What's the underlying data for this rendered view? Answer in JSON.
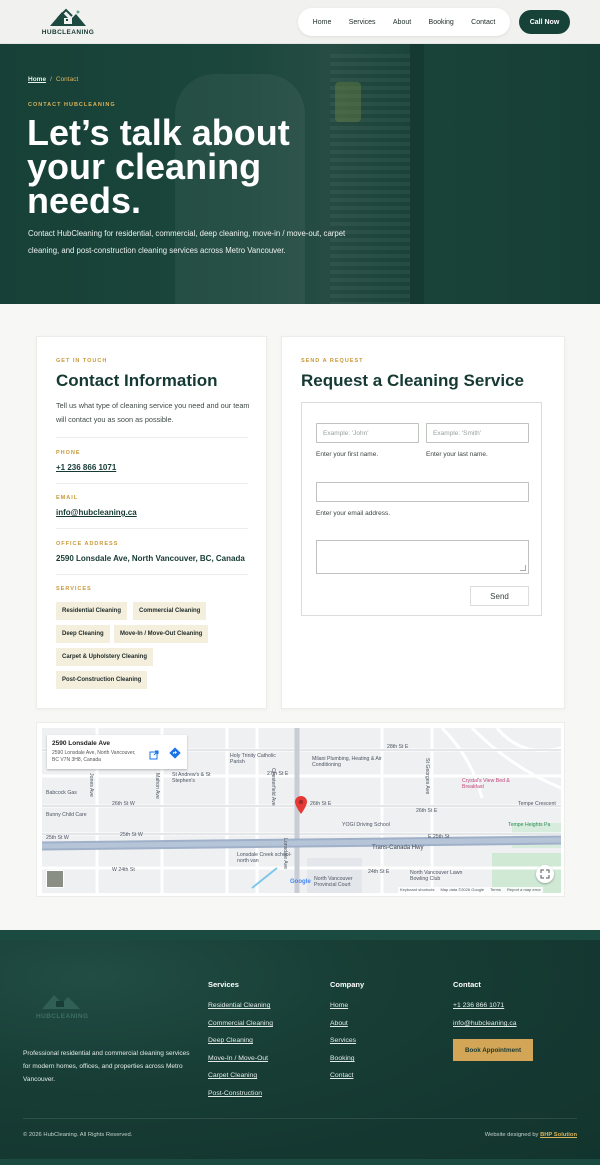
{
  "header": {
    "logo_text": "HUBCLEANING",
    "nav": [
      "Home",
      "Services",
      "About",
      "Booking",
      "Contact"
    ],
    "cta": "Call Now"
  },
  "hero": {
    "breadcrumb_home": "Home",
    "breadcrumb_sep": "/",
    "breadcrumb_current": "Contact",
    "eyebrow": "CONTACT HUBCLEANING",
    "title": "Let’s talk about your cleaning needs.",
    "description": "Contact HubCleaning for residential, commercial, deep cleaning, move-in / move-out, carpet cleaning, and post-construction cleaning services across Metro Vancouver."
  },
  "contact_card": {
    "eyebrow": "GET IN TOUCH",
    "title": "Contact Information",
    "description": "Tell us what type of cleaning service you need and our team will contact you as soon as possible.",
    "phone_label": "PHONE",
    "phone": "+1 236 866 1071",
    "email_label": "EMAIL",
    "email": "info@hubcleaning.ca",
    "address_label": "OFFICE ADDRESS",
    "address": "2590 Lonsdale Ave, North Vancouver, BC, Canada",
    "services_label": "SERVICES",
    "services": [
      "Residential Cleaning",
      "Commercial Cleaning",
      "Deep Cleaning",
      "Move-In / Move-Out Cleaning",
      "Carpet & Upholstery Cleaning",
      "Post-Construction Cleaning"
    ]
  },
  "request_card": {
    "eyebrow": "SEND A REQUEST",
    "title": "Request a Cleaning Service",
    "first_placeholder": "Example: 'John'",
    "first_help": "Enter your first name.",
    "last_placeholder": "Example: 'Smith'",
    "last_help": "Enter your last name.",
    "email_placeholder": "",
    "email_help": "Enter your email address.",
    "message_placeholder": "",
    "send": "Send"
  },
  "map": {
    "place_title": "2590 Lonsdale Ave",
    "place_address": "2590 Lonsdale Ave, North Vancouver, BC V7N 3H8, Canada",
    "labels": {
      "holy_trinity": "Holy Trinity Catholic Parish",
      "milani": "Milani Plumbing, Heating & Air Conditioning",
      "st_andrews": "St Andrew's & St Stephen's",
      "babcock": "Babcock Gas",
      "bunny": "Bunny Child Care",
      "crystals": "Crystal's View Bed & Breakfast",
      "yogi": "YOGI Driving School",
      "tempe_heights": "Tempe Heights Pa",
      "lonsdale_school": "Lonsdale Creek school-north van",
      "nv_court": "North Vancouver Provincial Court",
      "lawn_bowling": "North Vancouver Lawn Bowling Club",
      "trans_canada": "Trans-Canada Hwy",
      "st_28": "28th St E",
      "st_27": "27th St E",
      "st_26e": "26th St E",
      "st_26w": "26th St W",
      "st_26e2": "26th St E",
      "st_25w": "25th St W",
      "st_25w2": "25th St W",
      "st_25e": "E 25th St",
      "st_24e": "24th St E",
      "st_24w": "W 24th St",
      "lonsdale_ave": "Lonsdale Ave",
      "chesterfield": "Chesterfield Ave",
      "jones": "Jones Ave",
      "mahon": "Mahon Ave",
      "st_georges": "St Georges Ave",
      "tempe_cres": "Tempe Crescent",
      "keyboard": "Keyboard shortcuts",
      "mapdata": "Map data ©2026 Google",
      "terms": "Terms",
      "report": "Report a map error",
      "google": "Google"
    }
  },
  "footer": {
    "logo_text": "HUBCLEANING",
    "description": "Professional residential and commercial cleaning services for modern homes, offices, and properties across Metro Vancouver.",
    "services_title": "Services",
    "services": [
      "Residential Cleaning",
      "Commercial Cleaning",
      "Deep Cleaning",
      "Move-In / Move-Out",
      "Carpet Cleaning",
      "Post-Construction"
    ],
    "company_title": "Company",
    "company": [
      "Home",
      "About",
      "Services",
      "Booking",
      "Contact"
    ],
    "contact_title": "Contact",
    "phone": "+1 236 866 1071",
    "email": "info@hubcleaning.ca",
    "cta": "Book Appointment",
    "copyright": "© 2026 HubCleaning. All Rights Reserved.",
    "credit_prefix": "Website designed by ",
    "credit_name": "BHP Solution"
  },
  "colors": {
    "brand_dark": "#164238",
    "accent_gold": "#d3a557",
    "chip_bg": "#f4eedd"
  }
}
